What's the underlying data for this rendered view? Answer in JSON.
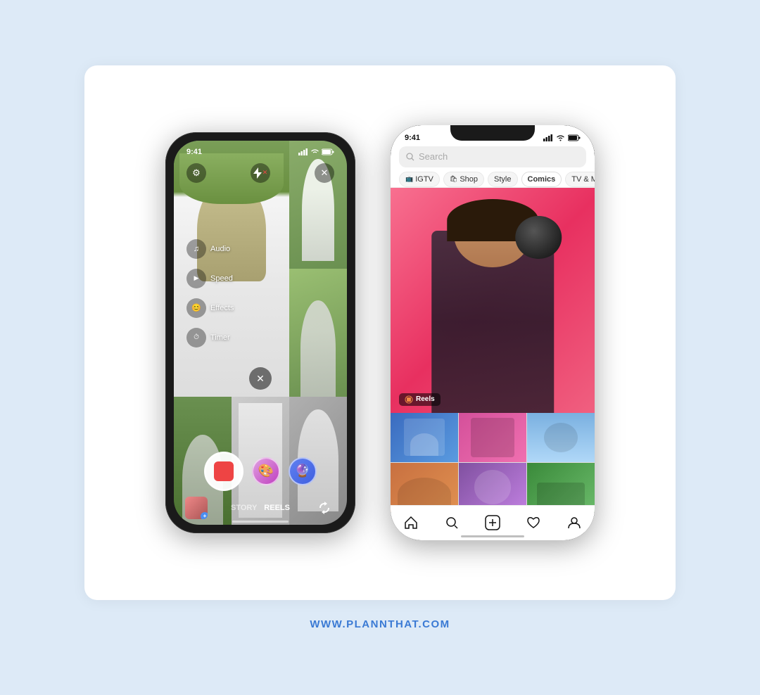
{
  "background": "#ddeaf7",
  "card": {
    "background": "#ffffff"
  },
  "website": {
    "url": "WWW.PLANNTHAT.COM"
  },
  "phone_left": {
    "status": {
      "time": "9:41",
      "signal": "▌▌▌",
      "wifi": "WiFi",
      "battery": "🔋"
    },
    "top_icons": {
      "settings": "⚙",
      "flash": "⚡",
      "close": "✕"
    },
    "tools": [
      {
        "icon": "♫",
        "label": "Audio"
      },
      {
        "icon": "▶",
        "label": "Speed"
      },
      {
        "icon": "😊",
        "label": "Effects"
      },
      {
        "icon": "⏱",
        "label": "Timer"
      }
    ],
    "bottom": {
      "modes": [
        "STORY",
        "REELS"
      ],
      "active_mode": "REELS"
    }
  },
  "phone_right": {
    "status": {
      "time": "9:41"
    },
    "search_placeholder": "Search",
    "tabs": [
      {
        "label": "IGTV",
        "icon": "📺",
        "active": false
      },
      {
        "label": "Shop",
        "icon": "🛍",
        "active": false
      },
      {
        "label": "Style",
        "icon": "",
        "active": false
      },
      {
        "label": "Comics",
        "icon": "",
        "active": true
      },
      {
        "label": "TV & Movie",
        "icon": "",
        "active": false
      }
    ],
    "reels_label": "Reels",
    "bottom_nav": [
      {
        "icon": "⌂",
        "name": "home"
      },
      {
        "icon": "🔍",
        "name": "search"
      },
      {
        "icon": "+",
        "name": "add"
      },
      {
        "icon": "♡",
        "name": "heart"
      },
      {
        "icon": "👤",
        "name": "profile"
      }
    ]
  }
}
